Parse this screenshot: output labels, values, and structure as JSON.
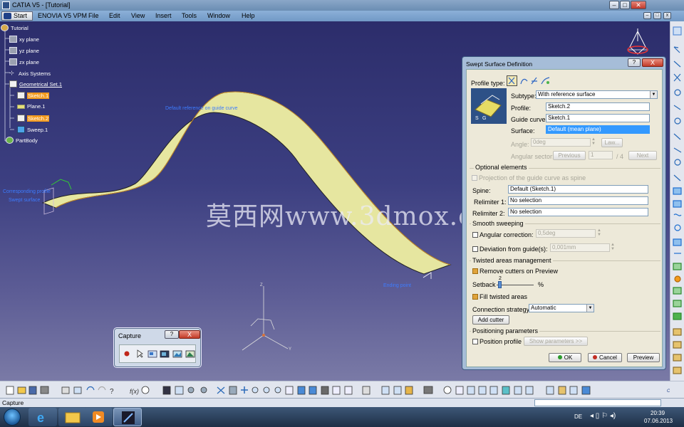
{
  "window": {
    "title": "CATIA V5 - [Tutorial]"
  },
  "menu": {
    "start": "Start",
    "enovia": "ENOVIA V5 VPM",
    "items": [
      "File",
      "Edit",
      "View",
      "Insert",
      "Tools",
      "Window",
      "Help"
    ]
  },
  "tree": {
    "root": "Tutorial",
    "xy": "xy plane",
    "yz": "yz plane",
    "zx": "zx plane",
    "axis": "Axis Systems",
    "geoset": "Geometrical Set.1",
    "sketch1": "Sketch.1",
    "plane1": "Plane.1",
    "sketch2": "Sketch.2",
    "sweep1": "Sweep.1",
    "partbody": "PartBody"
  },
  "viewport": {
    "label_reference": "Default reference on guide curve",
    "label_profile_1": "Corresponding profile",
    "label_profile_2": "Swept surface",
    "label_end": "Ending point",
    "watermark": "莫西网www.3dmox.com"
  },
  "capture_toolbar": {
    "title": "Capture",
    "help": "?",
    "close": "X",
    "icons": [
      "record-icon",
      "select-icon",
      "capture-area-icon",
      "camera-icon",
      "image-icon",
      "album-icon"
    ]
  },
  "dialog": {
    "title": "Swept Surface Definition",
    "help": "?",
    "close": "X",
    "profile_type_label": "Profile type:",
    "subtype_label": "Subtype:",
    "subtype_value": "With reference surface",
    "profile_label": "Profile:",
    "profile_value": "Sketch.2",
    "guide_label": "Guide curve:",
    "guide_value": "Sketch.1",
    "surface_label": "Surface:",
    "surface_value": "Default (mean plane)",
    "angle_label": "Angle:",
    "angle_value": "0deg",
    "law_button": "Law...",
    "angular_sector_label": "Angular sector:",
    "previous_button": "Previous",
    "sector_value": "1",
    "sector_total": "/ 4",
    "next_button": "Next",
    "optional_title": "Optional elements",
    "projection_label": "Projection of the guide curve as spine",
    "spine_label": "Spine:",
    "spine_value": "Default (Sketch.1)",
    "relimiter1_label": "Relimiter 1:",
    "relimiter1_value": "No selection",
    "relimiter2_label": "Relimiter 2:",
    "relimiter2_value": "No selection",
    "smooth_title": "Smooth sweeping",
    "angular_correction_label": "Angular correction:",
    "angular_correction_value": "0,5deg",
    "deviation_label": "Deviation from guide(s):",
    "deviation_value": "0,001mm",
    "twisted_title": "Twisted areas management",
    "remove_cutters_label": "Remove cutters on Preview",
    "setback_label": "Setback",
    "setback_value": "2",
    "setback_unit": "%",
    "fill_twisted_label": "Fill twisted areas",
    "connection_label": "Connection strategy:",
    "connection_value": "Automatic",
    "add_cutter": "Add cutter",
    "positioning_title": "Positioning parameters",
    "position_profile_label": "Position profile",
    "show_parameters": "Show parameters >>",
    "ok": "OK",
    "cancel": "Cancel",
    "preview": "Preview"
  },
  "status": {
    "text": "Capture"
  },
  "taskbar": {
    "lang": "DE",
    "time": "20:39",
    "date": "07.06.2013"
  },
  "colors": {
    "surface_fill": "#e6e6a0",
    "highlight": "#f39a1e",
    "viewport_top": "#2c2d6b"
  }
}
